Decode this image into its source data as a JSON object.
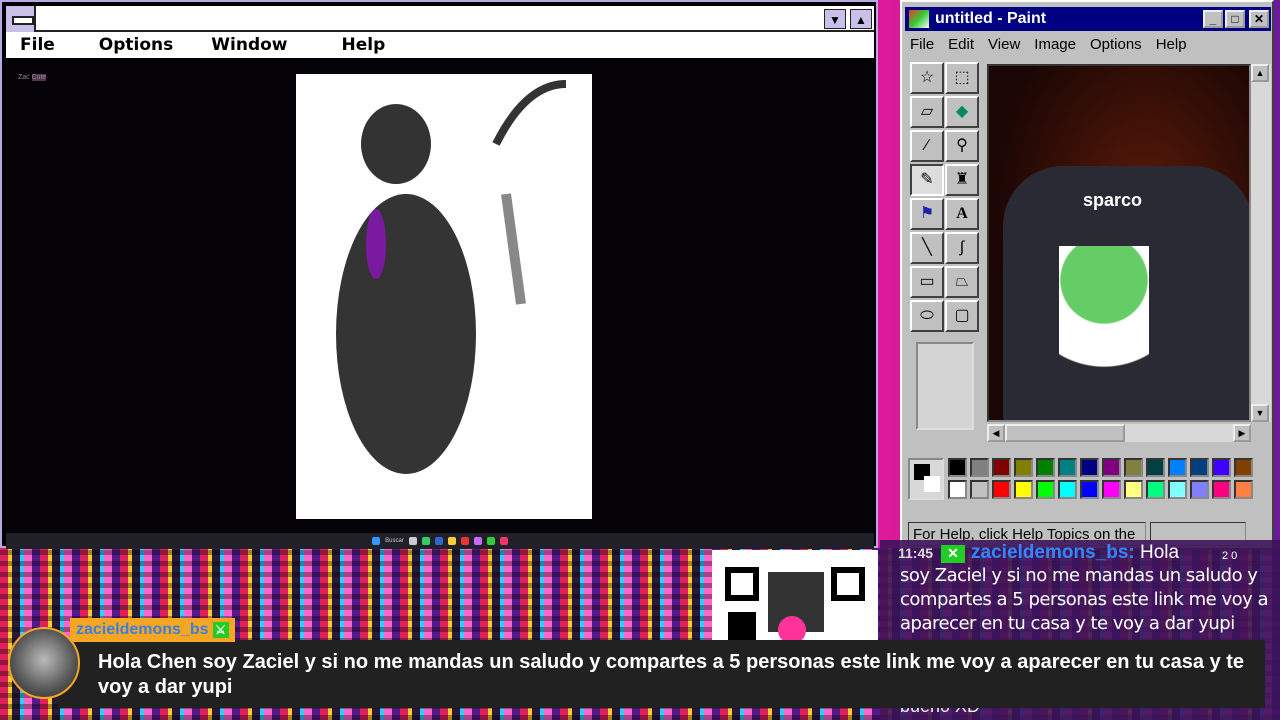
{
  "left_window": {
    "menu": [
      "File",
      "Options",
      "Window",
      "Help"
    ],
    "discord_user": "Zac",
    "discord_tag": "Cute",
    "taskbar_search": "Buscar"
  },
  "paint": {
    "title": "untitled - Paint",
    "menu": [
      "File",
      "Edit",
      "View",
      "Image",
      "Options",
      "Help"
    ],
    "tools": [
      "free-select",
      "rect-select",
      "eraser",
      "fill",
      "picker",
      "magnifier",
      "pencil",
      "brush",
      "airbrush",
      "text",
      "line",
      "curve",
      "rectangle",
      "polygon",
      "ellipse",
      "rounded-rect"
    ],
    "text_tool_label": "A",
    "canvas_logo": "sparco",
    "palette": [
      "#000000",
      "#808080",
      "#800000",
      "#808000",
      "#008000",
      "#008080",
      "#000080",
      "#800080",
      "#808040",
      "#004040",
      "#0080ff",
      "#004080",
      "#4000ff",
      "#804000",
      "#ffffff",
      "#c0c0c0",
      "#ff0000",
      "#ffff00",
      "#00ff00",
      "#00ffff",
      "#0000ff",
      "#ff00ff",
      "#ffff80",
      "#00ff80",
      "#80ffff",
      "#8080ff",
      "#ff0080",
      "#ff8040"
    ],
    "status": "For Help, click Help Topics on the"
  },
  "chat": {
    "time": "11:45",
    "username": "zacieldemons_bs:",
    "first_word": "Hola",
    "message": "soy Zaciel y si no me mandas un saludo y compartes a 5 personas este link me voy a aparecer en tu casa y te voy a dar yupi",
    "counts": "2   0",
    "next_message": "bueno XD"
  },
  "overlay": {
    "username": "zacieldemons_bs",
    "message": "Hola Chen soy Zaciel y si no me mandas un saludo y compartes a 5 personas este link me voy a aparecer en tu casa y te voy a dar yupi"
  }
}
